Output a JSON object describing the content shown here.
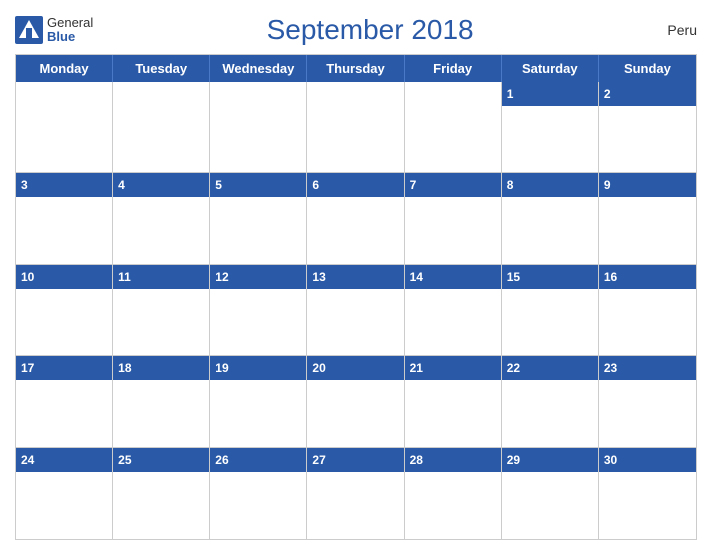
{
  "header": {
    "logo_general": "General",
    "logo_blue": "Blue",
    "title": "September 2018",
    "country": "Peru"
  },
  "days": [
    "Monday",
    "Tuesday",
    "Wednesday",
    "Thursday",
    "Friday",
    "Saturday",
    "Sunday"
  ],
  "weeks": [
    [
      {
        "num": "",
        "empty": true
      },
      {
        "num": "",
        "empty": true
      },
      {
        "num": "",
        "empty": true
      },
      {
        "num": "",
        "empty": true
      },
      {
        "num": "",
        "empty": true
      },
      {
        "num": "1",
        "empty": false
      },
      {
        "num": "2",
        "empty": false
      }
    ],
    [
      {
        "num": "3",
        "empty": false
      },
      {
        "num": "4",
        "empty": false
      },
      {
        "num": "5",
        "empty": false
      },
      {
        "num": "6",
        "empty": false
      },
      {
        "num": "7",
        "empty": false
      },
      {
        "num": "8",
        "empty": false
      },
      {
        "num": "9",
        "empty": false
      }
    ],
    [
      {
        "num": "10",
        "empty": false
      },
      {
        "num": "11",
        "empty": false
      },
      {
        "num": "12",
        "empty": false
      },
      {
        "num": "13",
        "empty": false
      },
      {
        "num": "14",
        "empty": false
      },
      {
        "num": "15",
        "empty": false
      },
      {
        "num": "16",
        "empty": false
      }
    ],
    [
      {
        "num": "17",
        "empty": false
      },
      {
        "num": "18",
        "empty": false
      },
      {
        "num": "19",
        "empty": false
      },
      {
        "num": "20",
        "empty": false
      },
      {
        "num": "21",
        "empty": false
      },
      {
        "num": "22",
        "empty": false
      },
      {
        "num": "23",
        "empty": false
      }
    ],
    [
      {
        "num": "24",
        "empty": false
      },
      {
        "num": "25",
        "empty": false
      },
      {
        "num": "26",
        "empty": false
      },
      {
        "num": "27",
        "empty": false
      },
      {
        "num": "28",
        "empty": false
      },
      {
        "num": "29",
        "empty": false
      },
      {
        "num": "30",
        "empty": false
      }
    ]
  ]
}
